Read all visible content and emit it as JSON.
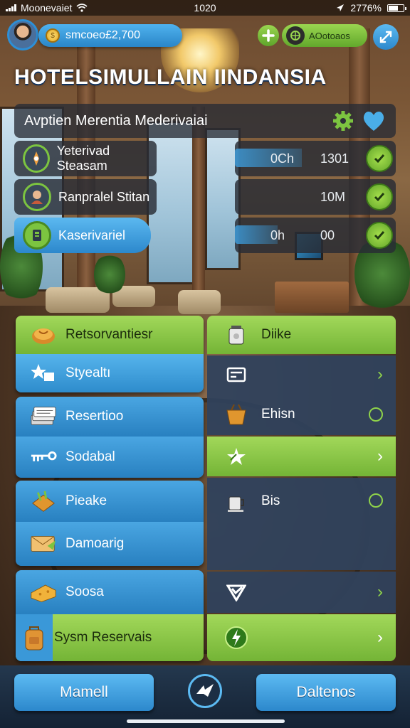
{
  "status_bar": {
    "carrier": "Moonevaiet",
    "time": "1020",
    "battery_text": "2776%",
    "battery_level": 0.7
  },
  "hud": {
    "coins": "smcoeo£2,700",
    "green_pill_label": "AOotoaos",
    "icons": {
      "plus": "plus-icon",
      "map": "map-icon",
      "expand": "expand-icon",
      "coin": "coin-icon"
    }
  },
  "title": "HOTELSIMULLAIN  IINDANSIA",
  "panel": {
    "header": "Avptien Merentia Mederivaiai",
    "header_icons": [
      "gear-icon",
      "heart-icon"
    ],
    "rows": [
      {
        "label": "Yeterivad Steasam",
        "icon": "compass-icon",
        "value1": "0Ch",
        "value2": "1301"
      },
      {
        "label": "Ranpralel Stitan",
        "icon": "bellhop-icon",
        "value1": "",
        "value2": "10M"
      },
      {
        "label": "Kaserivariel",
        "icon": "keycard-icon",
        "value1": "0h",
        "value2": "00"
      }
    ]
  },
  "left_menu": [
    {
      "label": "Retsorvantiesr",
      "icon": "bread-icon",
      "style": "green"
    },
    {
      "label": "Styealtı",
      "icon": "stars-icon",
      "style": "blue"
    },
    {
      "label": "Resertioo",
      "icon": "document-stack-icon",
      "style": "blue"
    },
    {
      "label": "Sodabal",
      "icon": "key-icon",
      "style": "blue"
    },
    {
      "label": "Pieake",
      "icon": "food-tray-icon",
      "style": "blue"
    },
    {
      "label": "Damoarig",
      "icon": "envelope-icon",
      "style": "blue"
    },
    {
      "label": "Soosa",
      "icon": "cheese-icon",
      "style": "blue"
    },
    {
      "label": "Sysm Reservais",
      "icon": "backpack-icon",
      "style": "green"
    }
  ],
  "right_menu": [
    {
      "label": "Diike",
      "icon": "jar-icon",
      "style": "green",
      "indicator": ""
    },
    {
      "label": "",
      "icon": "id-card-icon",
      "style": "slate",
      "indicator": "chevron"
    },
    {
      "label": "Ehisn",
      "icon": "basket-icon",
      "style": "slate",
      "indicator": "ring"
    },
    {
      "label": "",
      "icon": "star-icon",
      "style": "green",
      "indicator": "chevron"
    },
    {
      "label": "Bis",
      "icon": "coffee-icon",
      "style": "slate",
      "indicator": "ring"
    },
    {
      "label": "",
      "icon": "check-shield-icon",
      "style": "slate",
      "indicator": "chevron"
    },
    {
      "label": "",
      "icon": "lightning-icon",
      "style": "green",
      "indicator": "chevron"
    }
  ],
  "bottom": {
    "left_button": "Mamell",
    "right_button": "Daltenos",
    "center_icon": "bird-icon"
  }
}
